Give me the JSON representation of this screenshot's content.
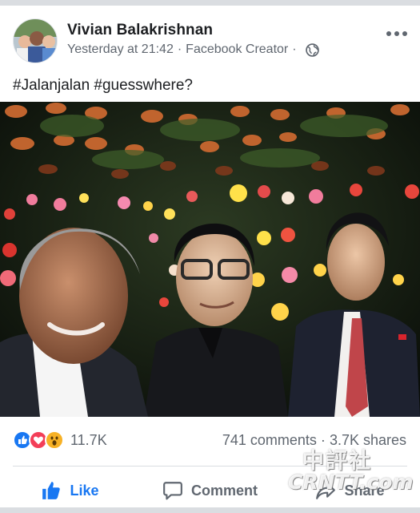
{
  "post": {
    "author": "Vivian Balakrishnan",
    "timestamp": "Yesterday at 21:42",
    "separator": "·",
    "source": "Facebook Creator",
    "separator2": "·",
    "text": "#Jalanjalan #guesswhere?"
  },
  "icons": {
    "more": "more-horizontal-icon",
    "privacy": "globe-icon",
    "like": "thumbs-up-icon",
    "comment": "speech-bubble-icon",
    "share": "share-arrow-icon"
  },
  "engagement": {
    "reaction_types": [
      "like",
      "love",
      "wow"
    ],
    "reaction_count": "11.7K",
    "comments": "741 comments",
    "counts_separator": "·",
    "shares": "3.7K shares"
  },
  "actions": {
    "like": "Like",
    "comment": "Comment",
    "share": "Share"
  },
  "watermark": {
    "line1": "中評社",
    "line2": "CRNTT.com"
  },
  "colors": {
    "accent": "#1877f2",
    "secondary_text": "#606770",
    "love": "#f33e58",
    "wow": "#f7b125"
  }
}
